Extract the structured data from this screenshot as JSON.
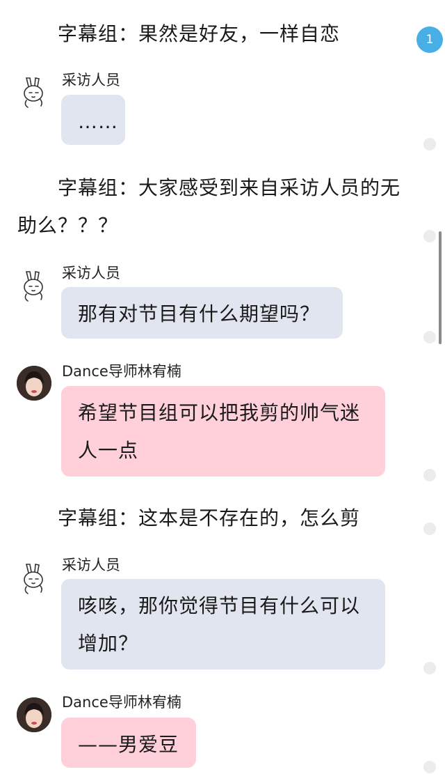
{
  "badge": {
    "count": "1"
  },
  "messages": [
    {
      "kind": "narration",
      "text": "字幕组：果然是好友，一样自恋"
    },
    {
      "kind": "chat",
      "speaker": "采访人员",
      "text": "……",
      "avatar": "rabbit-sticker-icon"
    },
    {
      "kind": "narration",
      "text": "字幕组：大家感受到来自采访人员的无助么？？？"
    },
    {
      "kind": "chat",
      "speaker": "采访人员",
      "text": "那有对节目有什么期望吗？",
      "avatar": "rabbit-sticker-icon"
    },
    {
      "kind": "chat",
      "speaker": "Dance导师林宥楠",
      "text": "希望节目组可以把我剪的帅气迷人一点",
      "avatar": "user-photo-avatar"
    },
    {
      "kind": "narration",
      "text": "字幕组：这本是不存在的，怎么剪"
    },
    {
      "kind": "chat",
      "speaker": "采访人员",
      "text": "咳咳，那你觉得节目有什么可以增加？",
      "avatar": "rabbit-sticker-icon"
    },
    {
      "kind": "chat",
      "speaker": "Dance导师林宥楠",
      "text": "——男爱豆",
      "avatar": "user-photo-avatar"
    }
  ],
  "colors": {
    "interviewer_bubble": "#e1e5f0",
    "mentor_bubble": "#ffd0da",
    "badge": "#49aee6"
  }
}
